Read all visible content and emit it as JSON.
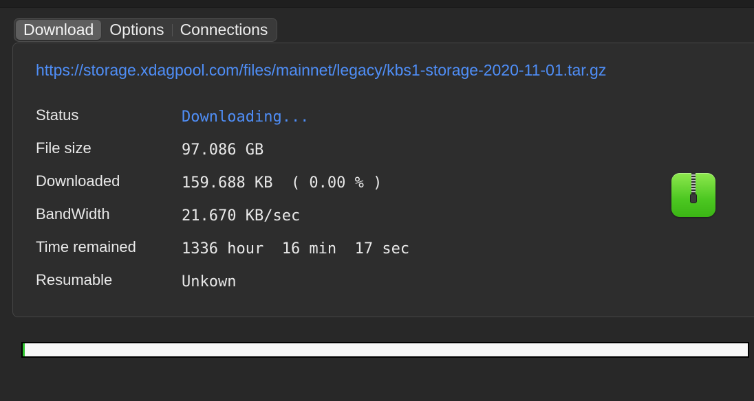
{
  "tabs": [
    {
      "label": "Download",
      "active": true
    },
    {
      "label": "Options",
      "active": false
    },
    {
      "label": "Connections",
      "active": false
    }
  ],
  "download": {
    "url": "https://storage.xdagpool.com/files/mainnet/legacy/kbs1-storage-2020-11-01.tar.gz",
    "rows": [
      {
        "label": "Status",
        "value": "Downloading..."
      },
      {
        "label": "File size",
        "value": "97.086 GB"
      },
      {
        "label": "Downloaded",
        "value": "159.688 KB  ( 0.00 % )"
      },
      {
        "label": "BandWidth",
        "value": "21.670 KB/sec"
      },
      {
        "label": "Time remained",
        "value": "1336 hour  16 min  17 sec"
      },
      {
        "label": "Resumable",
        "value": "Unkown"
      }
    ]
  },
  "icons": {
    "file_type": "archive-zip-icon"
  },
  "progress": {
    "fraction": 0.0
  },
  "colors": {
    "link": "#4f8ef7",
    "status": "#4f8ef7",
    "progress_fill": "#2fc52f",
    "icon_green": "#4cc721"
  }
}
